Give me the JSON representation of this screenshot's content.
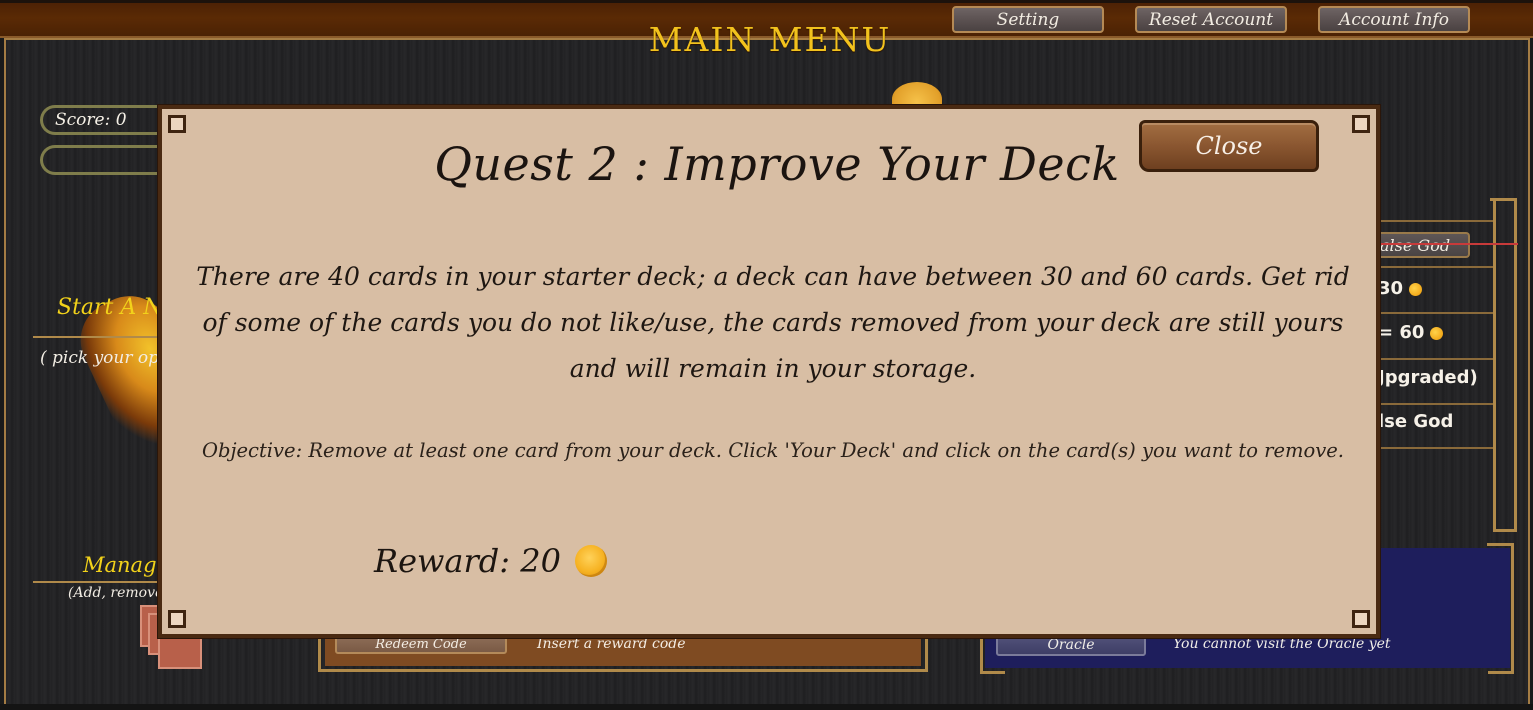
{
  "header": {
    "title": "MAIN MENU",
    "buttons": {
      "setting": "Setting",
      "reset_account": "Reset Account",
      "account_info": "Account Info"
    }
  },
  "left_panel": {
    "score": "Score: 0",
    "start_label": "Start A N",
    "start_sub": "( pick your op",
    "manage_label": "Manag",
    "manage_sub": "(Add, remove"
  },
  "redeem": {
    "button": "Redeem Code",
    "hint": "Insert a reward code"
  },
  "oracle": {
    "button": "Oracle",
    "status": "You cannot visit the Oracle yet"
  },
  "right_panel": {
    "false_god_button": "alse God",
    "rows": [
      {
        "text": "30",
        "coin": true
      },
      {
        "text": "= 60",
        "coin": true
      },
      {
        "text": "Jpgraded)",
        "coin": false
      },
      {
        "text": "lse God",
        "coin": false
      }
    ]
  },
  "quest_modal": {
    "title": "Quest 2 : Improve Your Deck",
    "close_label": "Close",
    "description": "There are 40 cards in your starter deck; a deck can have between 30 and 60 cards. Get rid of some of the cards you do not like/use, the cards removed from your deck are still yours and will remain in your storage.",
    "objective": "Objective: Remove at least one card from your deck. Click 'Your Deck' and click on the card(s) you want to remove.",
    "reward_label": "Reward: 20",
    "reward_icon": "gold-coin-icon"
  },
  "colors": {
    "title_gold": "#f2c21d",
    "modal_bg": "#d8bea4",
    "panel_brown": "#7f4b22",
    "panel_navy": "#1e1e5c"
  }
}
